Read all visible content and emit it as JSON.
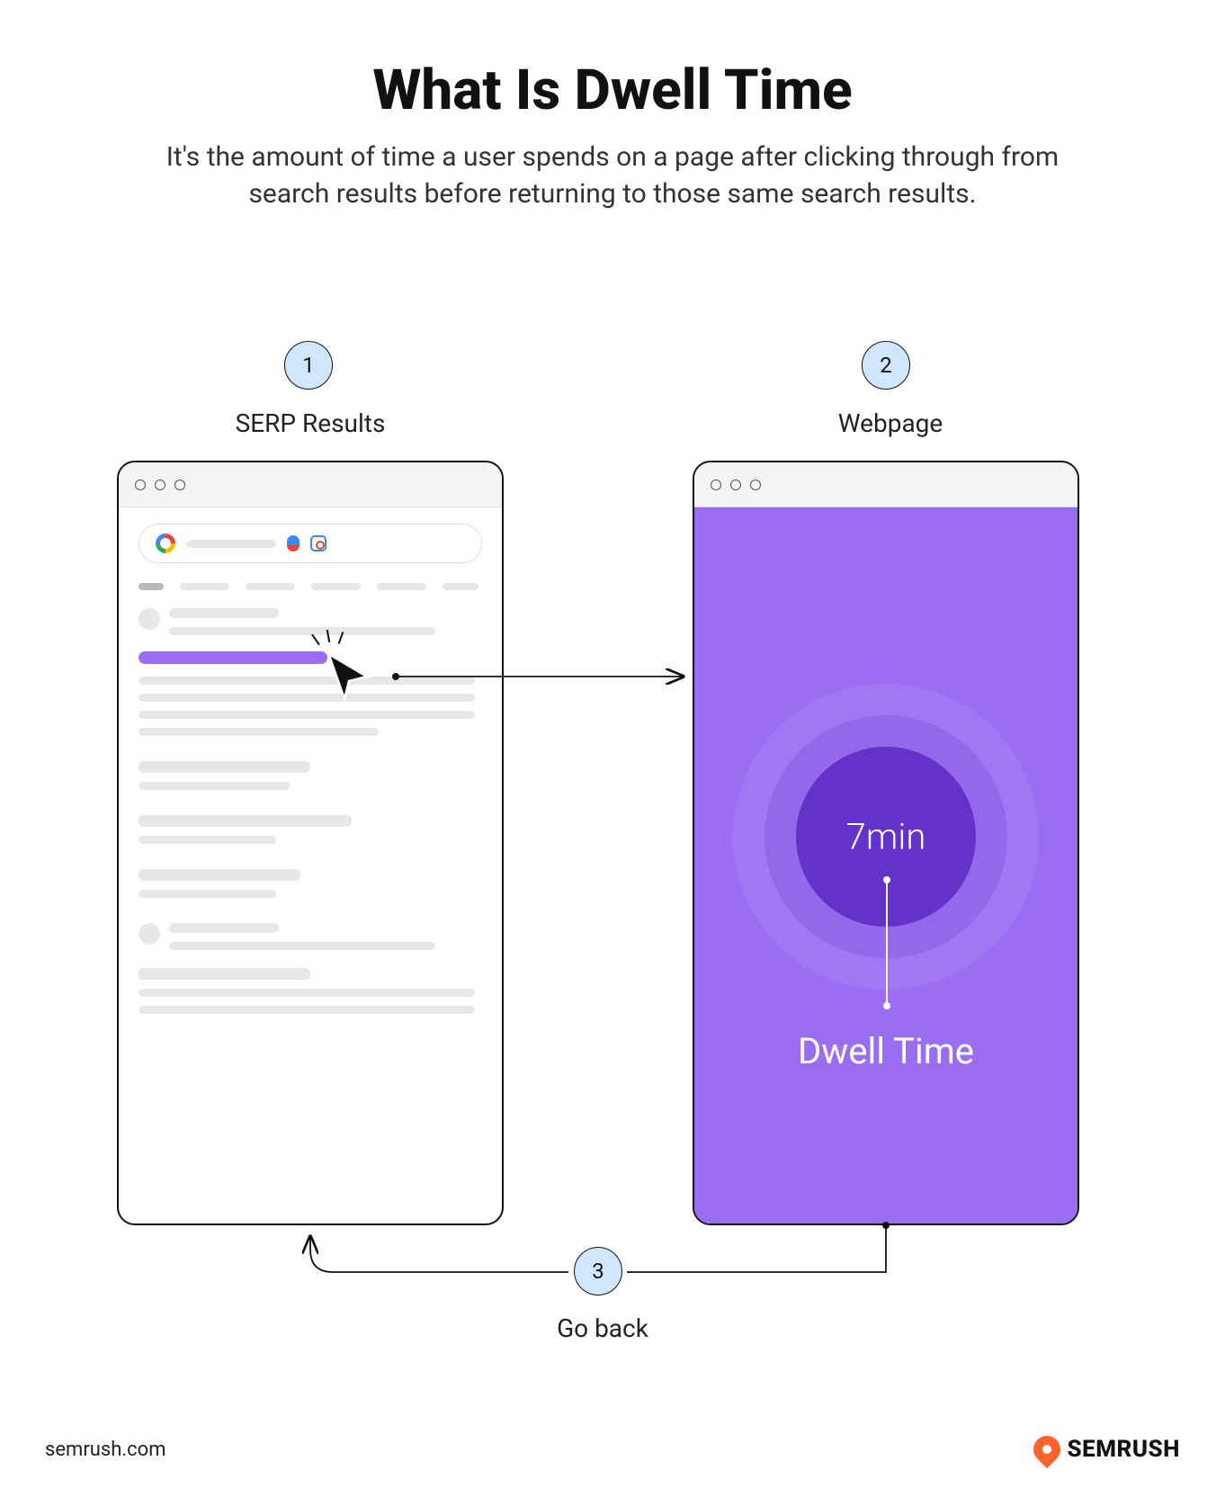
{
  "title": "What Is Dwell Time",
  "subtitle": "It's the amount of time a user spends on a page after clicking through from search results before returning to those same search results.",
  "steps": [
    {
      "num": "1",
      "label": "SERP Results"
    },
    {
      "num": "2",
      "label": "Webpage"
    },
    {
      "num": "3",
      "label": "Go back"
    }
  ],
  "webpage": {
    "time_value": "7min",
    "metric_label": "Dwell Time"
  },
  "footer": {
    "url": "semrush.com",
    "brand": "SEMRUSH"
  },
  "colors": {
    "accent_purple": "#9a6df3",
    "deep_purple": "#6432c8",
    "badge_blue": "#cfe8ff",
    "brand_orange": "#ff642d"
  }
}
